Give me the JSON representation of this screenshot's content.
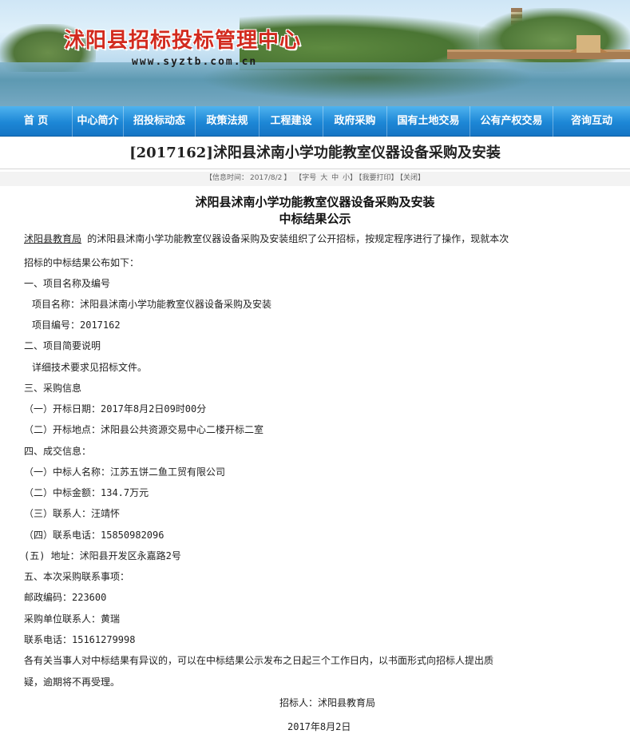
{
  "header": {
    "site_title": "沭阳县招标投标管理中心",
    "site_url": "www.syztb.com.cn"
  },
  "nav": {
    "items": [
      {
        "label": "首 页"
      },
      {
        "label": "中心简介"
      },
      {
        "label": "招投标动态"
      },
      {
        "label": "政策法规"
      },
      {
        "label": "工程建设"
      },
      {
        "label": "政府采购"
      },
      {
        "label": "国有土地交易"
      },
      {
        "label": "公有产权交易"
      },
      {
        "label": "咨询互动"
      }
    ]
  },
  "article": {
    "title": "[2017162]沭阳县沭南小学功能教室仪器设备采购及安装",
    "meta": {
      "info_time_label": "【信息时间：",
      "info_time_value": "2017/8/2",
      "font_size_label": "【字号",
      "size_large": "大",
      "size_medium": "中",
      "size_small": "小】",
      "print_label": "【我要打印】",
      "close_label": "【关闭】"
    },
    "heading_line1": "沭阳县沭南小学功能教室仪器设备采购及安装",
    "heading_line2": "中标结果公示",
    "intro_agency": "沭阳县教育局",
    "intro_rest": " 的沭阳县沭南小学功能教室仪器设备采购及安装组织了公开招标，按规定程序进行了操作，现就本次",
    "intro_line2": "招标的中标结果公布如下：",
    "section1": "一、项目名称及编号",
    "project_name": "项目名称：沭阳县沭南小学功能教室仪器设备采购及安装",
    "project_code": "项目编号：2017162",
    "section2": "二、项目简要说明",
    "detail_note": "详细技术要求见招标文件。",
    "section3": "三、采购信息",
    "open_date": "（一）开标日期：2017年8月2日09时00分",
    "open_place": "（二）开标地点：沭阳县公共资源交易中心二楼开标二室",
    "section4": "四、成交信息：",
    "winner": "（一）中标人名称：江苏五饼二鱼工贸有限公司",
    "amount": "（二）中标金额：134.7万元",
    "contact_person": "（三）联系人：汪靖怀",
    "contact_phone": "（四）联系电话：15850982096",
    "address": "(五) 地址：沭阳县开发区永嘉路2号",
    "section5": "五、本次采购联系事项：",
    "postcode": "邮政编码：223600",
    "buyer_contact": "采购单位联系人：黄瑞",
    "buyer_phone": "联系电话：15161279998",
    "objection_line1": "各有关当事人对中标结果有异议的，可以在中标结果公示发布之日起三个工作日内，以书面形式向招标人提出质",
    "objection_line2": "疑，逾期将不再受理。",
    "tenderer": "招标人：沭阳县教育局",
    "date": "2017年8月2日"
  },
  "colors": {
    "nav_blue": "#1d87d6",
    "title_red": "#d22a1e"
  }
}
